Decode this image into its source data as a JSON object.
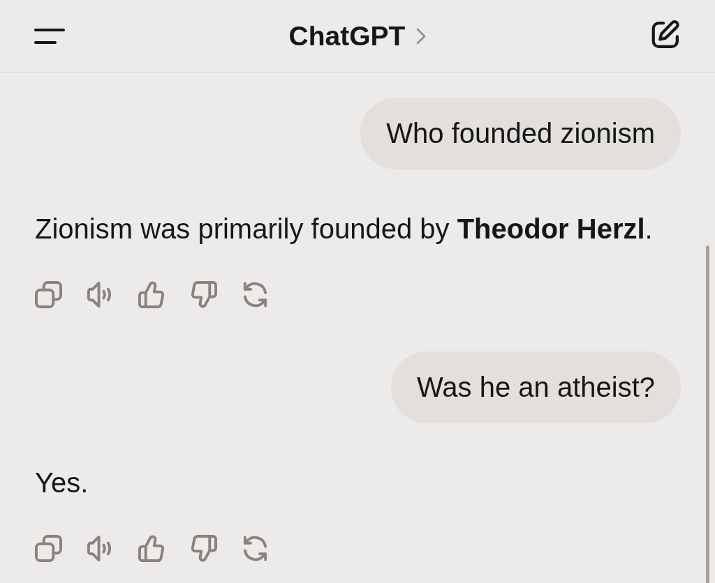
{
  "header": {
    "title": "ChatGPT"
  },
  "messages": [
    {
      "kind": "user",
      "text": "Who founded zionism"
    },
    {
      "kind": "assistant",
      "text": "Zionism was primarily founded by **Theodor Herzl**."
    },
    {
      "kind": "user",
      "text": "Was he an atheist?"
    },
    {
      "kind": "assistant",
      "text": "Yes."
    }
  ]
}
